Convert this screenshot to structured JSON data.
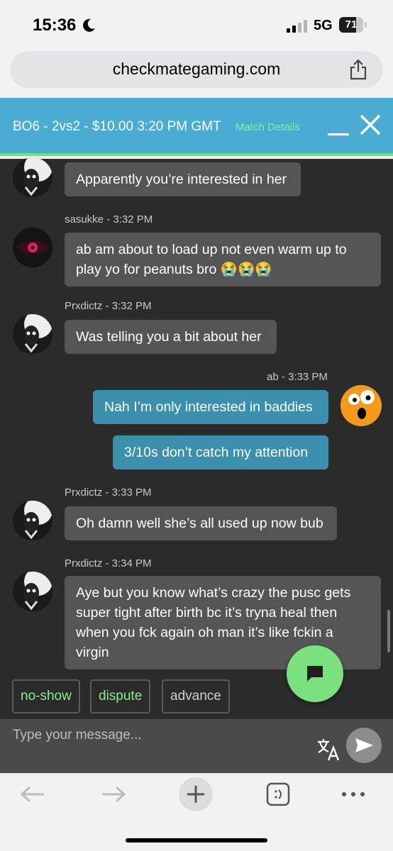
{
  "status_bar": {
    "time": "15:36",
    "network": "5G",
    "battery": "71",
    "battery_level": 0.71
  },
  "browser": {
    "url": "checkmategaming.com"
  },
  "match": {
    "title": "BO6 - 2vs2 - $10.00   3:20 PM GMT",
    "details_link": "Match Details"
  },
  "messages": [
    {
      "meta": "",
      "text": "Apparently you’re interested in her"
    },
    {
      "meta": "sasukke - 3:32 PM",
      "text": "ab am about to load up not even warm up to play yo for peanuts bro 😭😭😭"
    },
    {
      "meta": "Prxdictz - 3:32 PM",
      "text": "Was telling you a bit about her"
    },
    {
      "meta": "ab - 3:33 PM",
      "text": "Nah I’m only interested in baddies"
    },
    {
      "meta": "",
      "text": "3/10s don’t catch my attention"
    },
    {
      "meta": "Prxdictz - 3:33 PM",
      "text": "Oh damn well she’s all used up now bub"
    },
    {
      "meta": "Prxdictz - 3:34 PM",
      "text": "Aye but you know what’s crazy the pusc gets super tight after birth bc it’s tryna heal then when you fck again oh man it’s like fckin a virgin"
    }
  ],
  "actions": {
    "no_show": "no-show",
    "dispute": "dispute",
    "advance": "advance"
  },
  "composer": {
    "placeholder": "Type your message..."
  },
  "colors": {
    "header": "#4bacd3",
    "accent_green": "#7be17f",
    "my_bubble": "#3b90ad",
    "other_bubble": "#555557",
    "chat_bg": "#2b2b2b"
  }
}
